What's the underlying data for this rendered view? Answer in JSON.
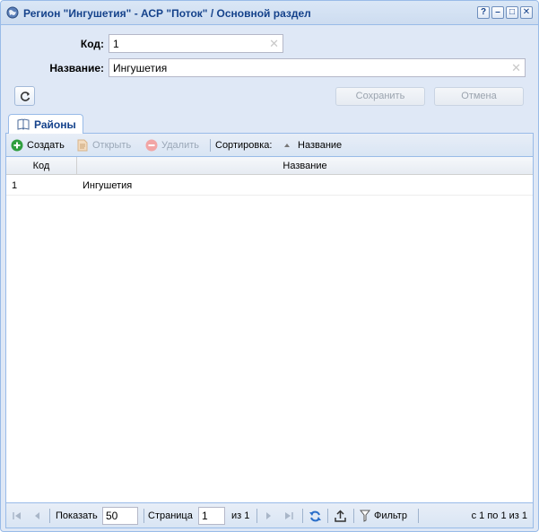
{
  "window": {
    "title": "Регион \"Ингушетия\" - АСР \"Поток\" / Основной раздел",
    "tools": {
      "help": "?",
      "minimize": "–",
      "maximize": "□",
      "close": "✕"
    }
  },
  "form": {
    "code_label": "Код:",
    "code_value": "1",
    "name_label": "Название:",
    "name_value": "Ингушетия",
    "save_label": "Сохранить",
    "cancel_label": "Отмена"
  },
  "tabs": [
    {
      "label": "Районы",
      "active": true
    }
  ],
  "toolbar": {
    "create": "Создать",
    "open": "Открыть",
    "delete": "Удалить",
    "sort_label": "Сортировка:",
    "sort_field": "Название"
  },
  "grid": {
    "columns": [
      "Код",
      "Название"
    ],
    "rows": [
      [
        "1",
        "Ингушетия"
      ]
    ]
  },
  "pager": {
    "show_label": "Показать",
    "page_size": "50",
    "page_label": "Страница",
    "page": "1",
    "of_label": "из 1",
    "filter_label": "Фильтр",
    "summary": "с 1 по 1 из 1"
  },
  "colors": {
    "accent": "#15428b",
    "border": "#99bbe8",
    "background": "#dfe8f6"
  }
}
